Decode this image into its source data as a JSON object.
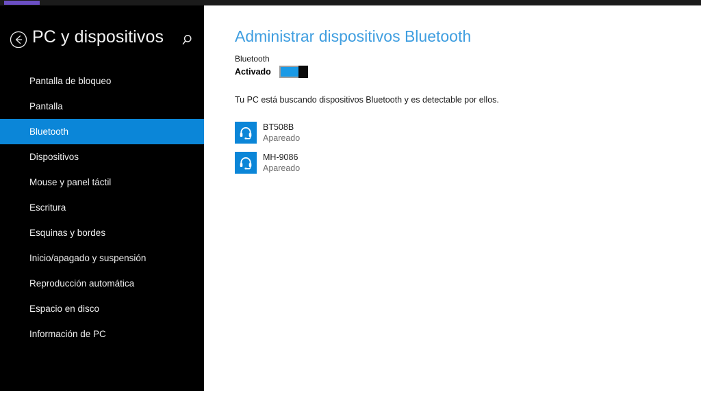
{
  "taskbar": {
    "item_label": ""
  },
  "panel": {
    "title": "PC y dispositivos",
    "back_icon": "back-arrow-circle-icon",
    "search_icon": "search-icon",
    "accent_color": "#0b86d8",
    "nav_items": [
      {
        "label": "Pantalla de bloqueo",
        "selected": false
      },
      {
        "label": "Pantalla",
        "selected": false
      },
      {
        "label": "Bluetooth",
        "selected": true
      },
      {
        "label": "Dispositivos",
        "selected": false
      },
      {
        "label": "Mouse y panel táctil",
        "selected": false
      },
      {
        "label": "Escritura",
        "selected": false
      },
      {
        "label": "Esquinas y bordes",
        "selected": false
      },
      {
        "label": "Inicio/apagado y suspensión",
        "selected": false
      },
      {
        "label": "Reproducción automática",
        "selected": false
      },
      {
        "label": "Espacio en disco",
        "selected": false
      },
      {
        "label": "Información de PC",
        "selected": false
      }
    ]
  },
  "content": {
    "title": "Administrar dispositivos Bluetooth",
    "title_color": "#3f9ee0",
    "bluetooth": {
      "label": "Bluetooth",
      "state_label": "Activado",
      "toggle_on": true,
      "toggle_fill_color": "#1a9ae6"
    },
    "status_text": "Tu PC está buscando dispositivos Bluetooth y es detectable por ellos.",
    "devices": [
      {
        "name": "BT508B",
        "status": "Apareado",
        "icon": "headset-icon"
      },
      {
        "name": "MH-9086",
        "status": "Apareado",
        "icon": "headset-icon"
      }
    ]
  }
}
